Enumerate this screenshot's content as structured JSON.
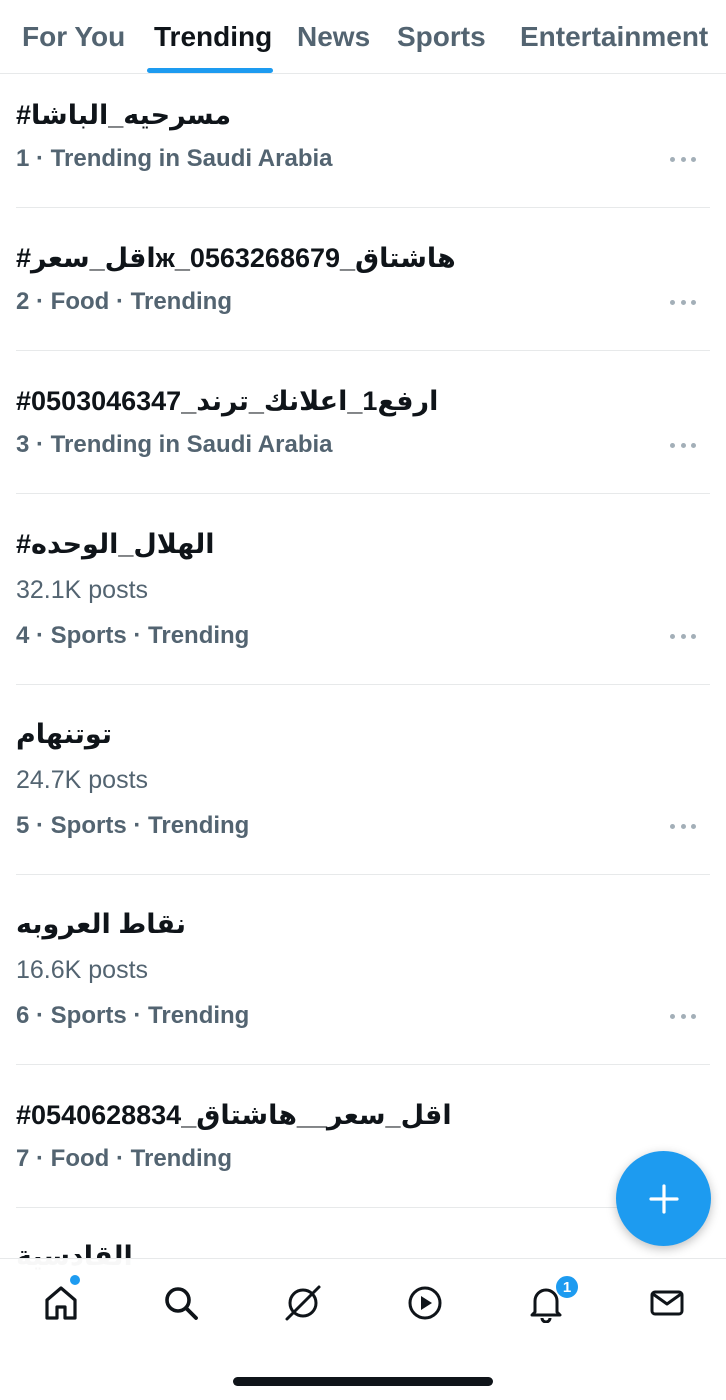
{
  "tabs": [
    {
      "label": "For You"
    },
    {
      "label": "Trending"
    },
    {
      "label": "News"
    },
    {
      "label": "Sports"
    },
    {
      "label": "Entertainment"
    }
  ],
  "active_tab": "Trending",
  "trends": [
    {
      "title": "#مسرحيه_الباشا",
      "posts": "",
      "meta": "1 · Trending in Saudi Arabia"
    },
    {
      "title": "#اقل_سعرж_هاشتاق_0563268679",
      "posts": "",
      "meta": "2 · Food · Trending"
    },
    {
      "title": "#ارفع1_اعلانك_ترند_0503046347",
      "posts": "",
      "meta": "3 · Trending in Saudi Arabia"
    },
    {
      "title": "#الهلال_الوحده",
      "posts": "32.1K posts",
      "meta": "4 · Sports · Trending"
    },
    {
      "title": "توتنهام",
      "posts": "24.7K posts",
      "meta": "5 · Sports · Trending"
    },
    {
      "title": "نقاط العروبه",
      "posts": "16.6K posts",
      "meta": "6 · Sports · Trending"
    },
    {
      "title": "#اقل_سعر__هاشتاق_0540628834",
      "posts": "",
      "meta": "7 · Food · Trending"
    }
  ],
  "partial_trend_title": "القادسية",
  "notifications_count": "1",
  "bottom_nav": {
    "items": [
      "home-icon",
      "search-icon",
      "grok-icon",
      "video-icon",
      "notifications-icon",
      "messages-icon"
    ]
  },
  "colors": {
    "accent": "#1d9bf0",
    "text_primary": "#0f1419",
    "text_secondary": "#536471",
    "divider": "#e7e9ea"
  }
}
